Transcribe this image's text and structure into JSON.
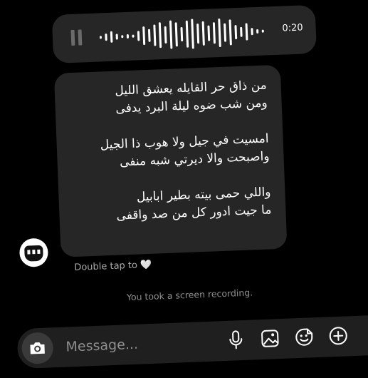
{
  "voice_message": {
    "duration": "0:20"
  },
  "message": {
    "text": "من ذاق حر القايله يعشق الليل\nومن شب ضوه ليلة البرد يدفى\n\nامسيت في جيل ولا هوب ذا الجيل\nواصبحت والا ديرتي شبه منفى\n\nواللي حمى بيته بطير ابابيل\nما جيت ادور كل من صد واقفى"
  },
  "hint": {
    "text": "Double tap to",
    "heart": "🤍"
  },
  "status": {
    "text": "You took a screen recording."
  },
  "composer": {
    "placeholder": "Message..."
  },
  "icons": [
    "pause-icon",
    "waveform",
    "camera-icon",
    "microphone-icon",
    "gallery-icon",
    "sticker-icon",
    "plus-icon"
  ]
}
